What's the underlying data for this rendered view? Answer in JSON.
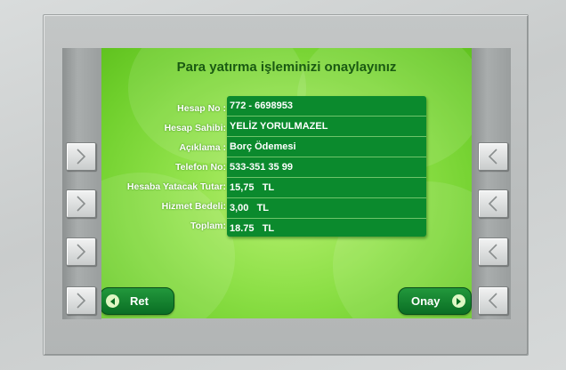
{
  "screen": {
    "title": "Para yatırma işleminizi onaylayınız"
  },
  "details": [
    {
      "label": "Hesap No :",
      "value": "772 - 6698953"
    },
    {
      "label": "Hesap Sahibi:",
      "value": "YELİZ YORULMAZEL"
    },
    {
      "label": "Açıklama :",
      "value": "Borç Ödemesi"
    },
    {
      "label": "Telefon No:",
      "value": "533-351 35 99"
    },
    {
      "label": "Hesaba Yatacak Tutar:",
      "value": "15,75   TL"
    },
    {
      "label": "Hizmet Bedeli:",
      "value": "3,00   TL"
    },
    {
      "label": "Toplam:",
      "value": "18.75   TL"
    }
  ],
  "buttons": {
    "cancel_label": "Ret",
    "confirm_label": "Onay"
  },
  "icons": {
    "cancel": "arrow-left-circle-icon",
    "confirm": "arrow-right-circle-icon",
    "left_keys": "chevron-right-icon",
    "right_keys": "chevron-left-icon"
  },
  "colors": {
    "screen_green": "#8ee048",
    "panel_green": "#0b8a2d",
    "title_green": "#1a5a12",
    "button_green": "#0a6e24"
  }
}
